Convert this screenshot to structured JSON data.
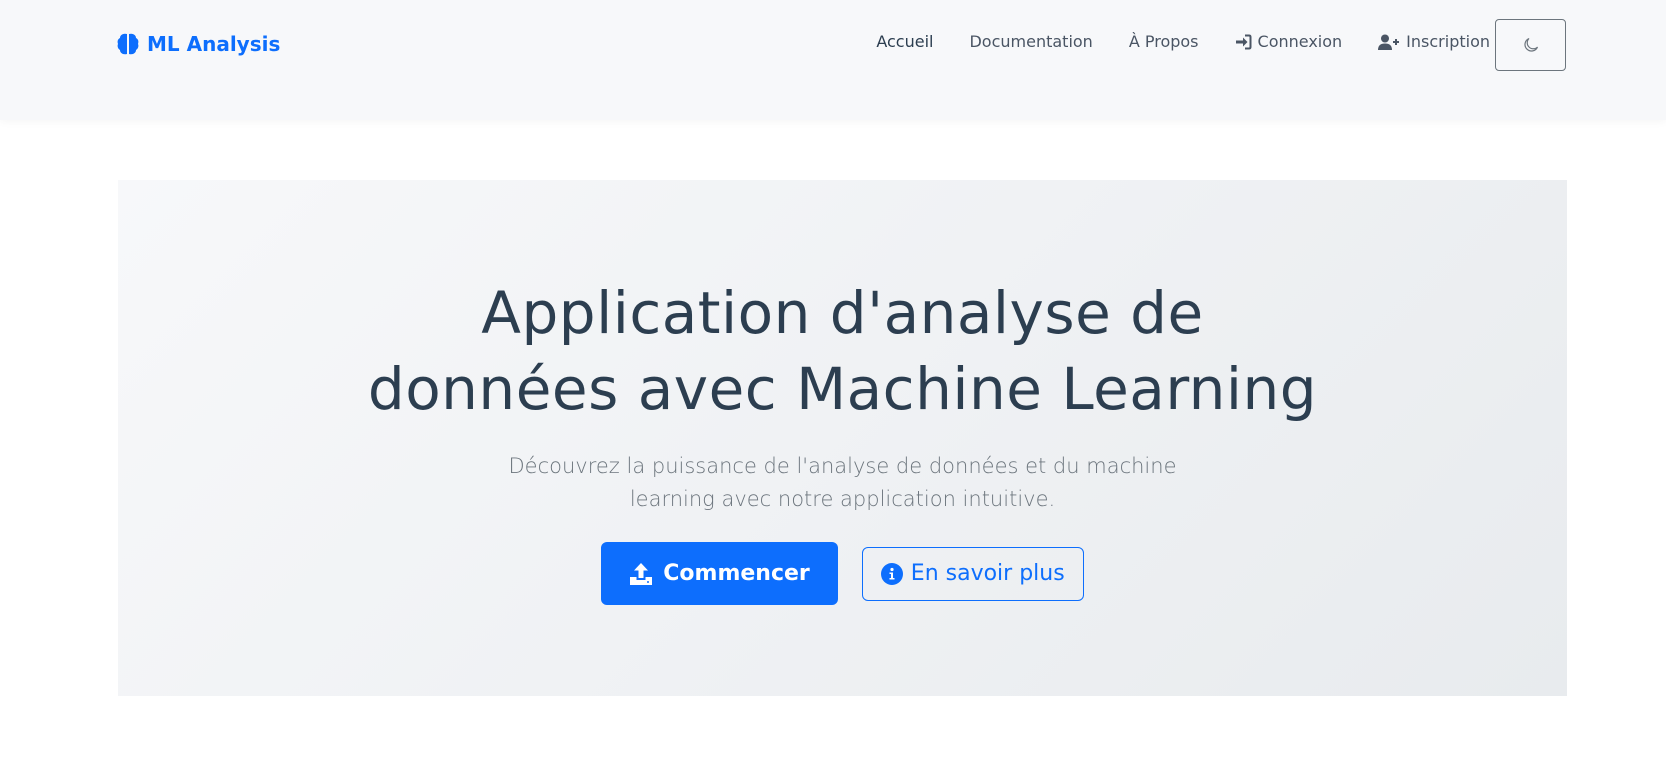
{
  "brand": {
    "name": "ML Analysis",
    "icon": "brain-icon"
  },
  "nav": {
    "items": [
      {
        "label": "Accueil",
        "active": true
      },
      {
        "label": "Documentation"
      },
      {
        "label": "À Propos"
      },
      {
        "label": "Connexion",
        "icon": "sign-in-icon"
      },
      {
        "label": "Inscription",
        "icon": "user-plus-icon"
      }
    ],
    "theme_toggle_icon": "moon-icon"
  },
  "hero": {
    "title_line1": "Application d'analyse de",
    "title_line2": "données avec Machine Learning",
    "subtitle": "Découvrez la puissance de l'analyse de données et du machine learning avec notre application intuitive.",
    "primary_button": {
      "label": "Commencer",
      "icon": "upload-icon"
    },
    "secondary_button": {
      "label": "En savoir plus",
      "icon": "info-circle-icon"
    }
  },
  "colors": {
    "primary": "#0d6efd",
    "heading": "#2c3e50",
    "muted": "#6c757d",
    "navbar_bg": "#f7f8fa"
  }
}
